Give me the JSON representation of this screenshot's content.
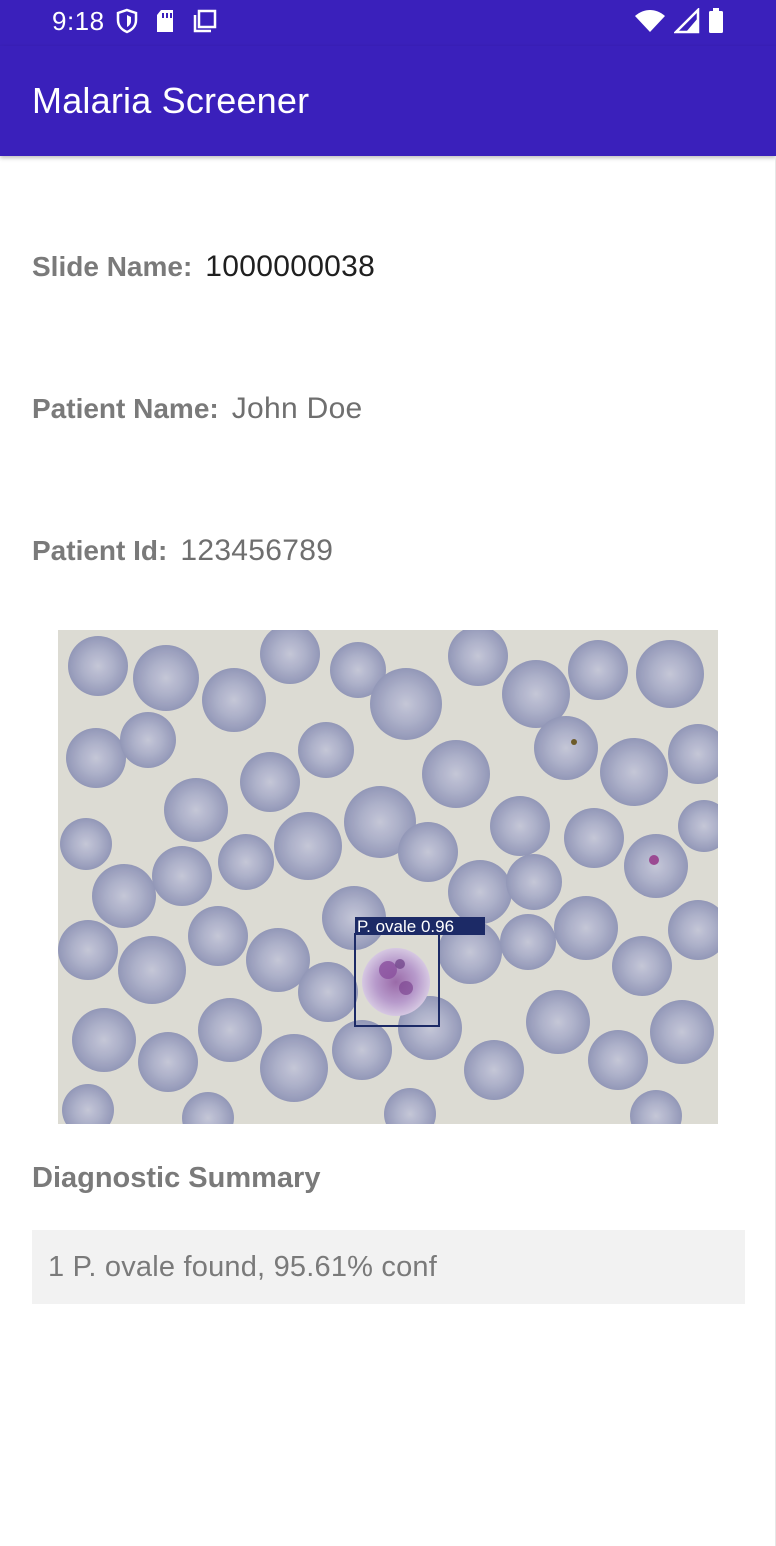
{
  "status_bar": {
    "time": "9:18",
    "left_icons": [
      "vpn-shield-icon",
      "sd-card-icon",
      "copy-stack-icon"
    ],
    "right_icons": [
      "wifi-icon",
      "cell-signal-icon",
      "battery-icon"
    ]
  },
  "app_bar": {
    "title": "Malaria Screener"
  },
  "fields": {
    "slide_name": {
      "label": "Slide Name:",
      "value": "1000000038"
    },
    "patient_name": {
      "label": "Patient Name:",
      "value": "John Doe"
    },
    "patient_id": {
      "label": "Patient Id:",
      "value": "123456789"
    }
  },
  "slide_image": {
    "detection_label": "P. ovale 0.96",
    "box_color": "#1c2a66"
  },
  "summary": {
    "heading": "Diagnostic Summary",
    "text": "1 P. ovale found, 95.61% conf"
  },
  "colors": {
    "primary": "#3a20bb",
    "label_gray": "#7a7a7a",
    "summary_bg": "#f2f2f2"
  }
}
